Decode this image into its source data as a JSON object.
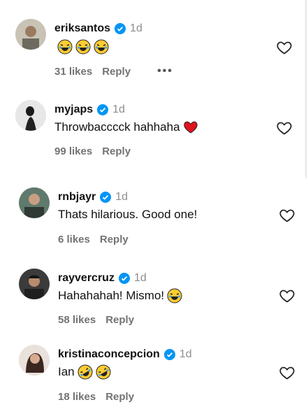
{
  "comments": [
    {
      "username": "eriksantos",
      "time": "1d",
      "text": "",
      "emojis": [
        "joy",
        "joy",
        "joy"
      ],
      "likes": "31 likes",
      "reply": "Reply",
      "more": "•••"
    },
    {
      "username": "myjaps",
      "time": "1d",
      "text": "Throwbacccck hahhaha",
      "emojis": [
        "red-heart"
      ],
      "likes": "99 likes",
      "reply": "Reply"
    },
    {
      "username": "rnbjayr",
      "time": "1d",
      "text": "Thats hilarious. Good one!",
      "emojis": [],
      "likes": "6 likes",
      "reply": "Reply"
    },
    {
      "username": "rayvercruz",
      "time": "1d",
      "text": "Hahahahah! Mismo!",
      "emojis": [
        "joy"
      ],
      "likes": "58 likes",
      "reply": "Reply"
    },
    {
      "username": "kristinaconcepcion",
      "time": "1d",
      "text": "Ian",
      "emojis": [
        "rofl",
        "rofl"
      ],
      "likes": "18 likes",
      "reply": "Reply"
    }
  ],
  "colors": {
    "verified": "#0095f6",
    "heart": "#e0141e",
    "emoji_face": "#ffcc33"
  }
}
